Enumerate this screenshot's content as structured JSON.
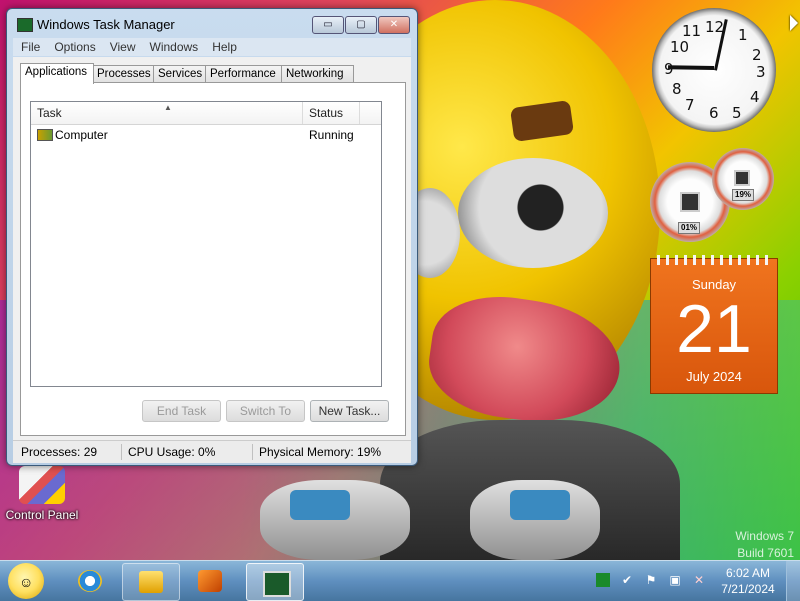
{
  "window": {
    "title": "Windows Task Manager",
    "controls": {
      "minimize": "▭",
      "maximize": "▢",
      "close": "✕"
    }
  },
  "menu": [
    "File",
    "Options",
    "View",
    "Windows",
    "Help"
  ],
  "tabs": [
    "Applications",
    "Processes",
    "Services",
    "Performance",
    "Networking"
  ],
  "active_tab": "Applications",
  "task_list": {
    "columns": [
      "Task",
      "Status"
    ],
    "rows": [
      {
        "task": "Computer",
        "status": "Running"
      }
    ]
  },
  "buttons": {
    "end_task": "End Task",
    "switch_to": "Switch To",
    "new_task": "New Task..."
  },
  "status_bar": {
    "processes": "Processes: 29",
    "cpu": "CPU Usage: 0%",
    "memory": "Physical Memory: 19%"
  },
  "gadgets": {
    "clock": {
      "hour": 9,
      "minute": 2,
      "numbers": [
        "12",
        "1",
        "2",
        "3",
        "4",
        "5",
        "6",
        "7",
        "8",
        "9",
        "10",
        "11"
      ]
    },
    "cpu_meter": {
      "cpu_percent": "01%",
      "memory_percent": "19%"
    },
    "calendar": {
      "weekday": "Sunday",
      "day": "21",
      "month_year": "July 2024"
    }
  },
  "desktop": {
    "icons": [
      {
        "label": "Control Panel",
        "icon": "control-panel-icon"
      }
    ],
    "watermark": [
      "Windows 7",
      "Build 7601"
    ]
  },
  "taskbar": {
    "time": "6:02 AM",
    "date": "7/21/2024",
    "pinned": [
      "start-orb-icon",
      "internet-explorer-icon",
      "windows-explorer-icon",
      "media-player-icon",
      "task-manager-icon"
    ]
  }
}
